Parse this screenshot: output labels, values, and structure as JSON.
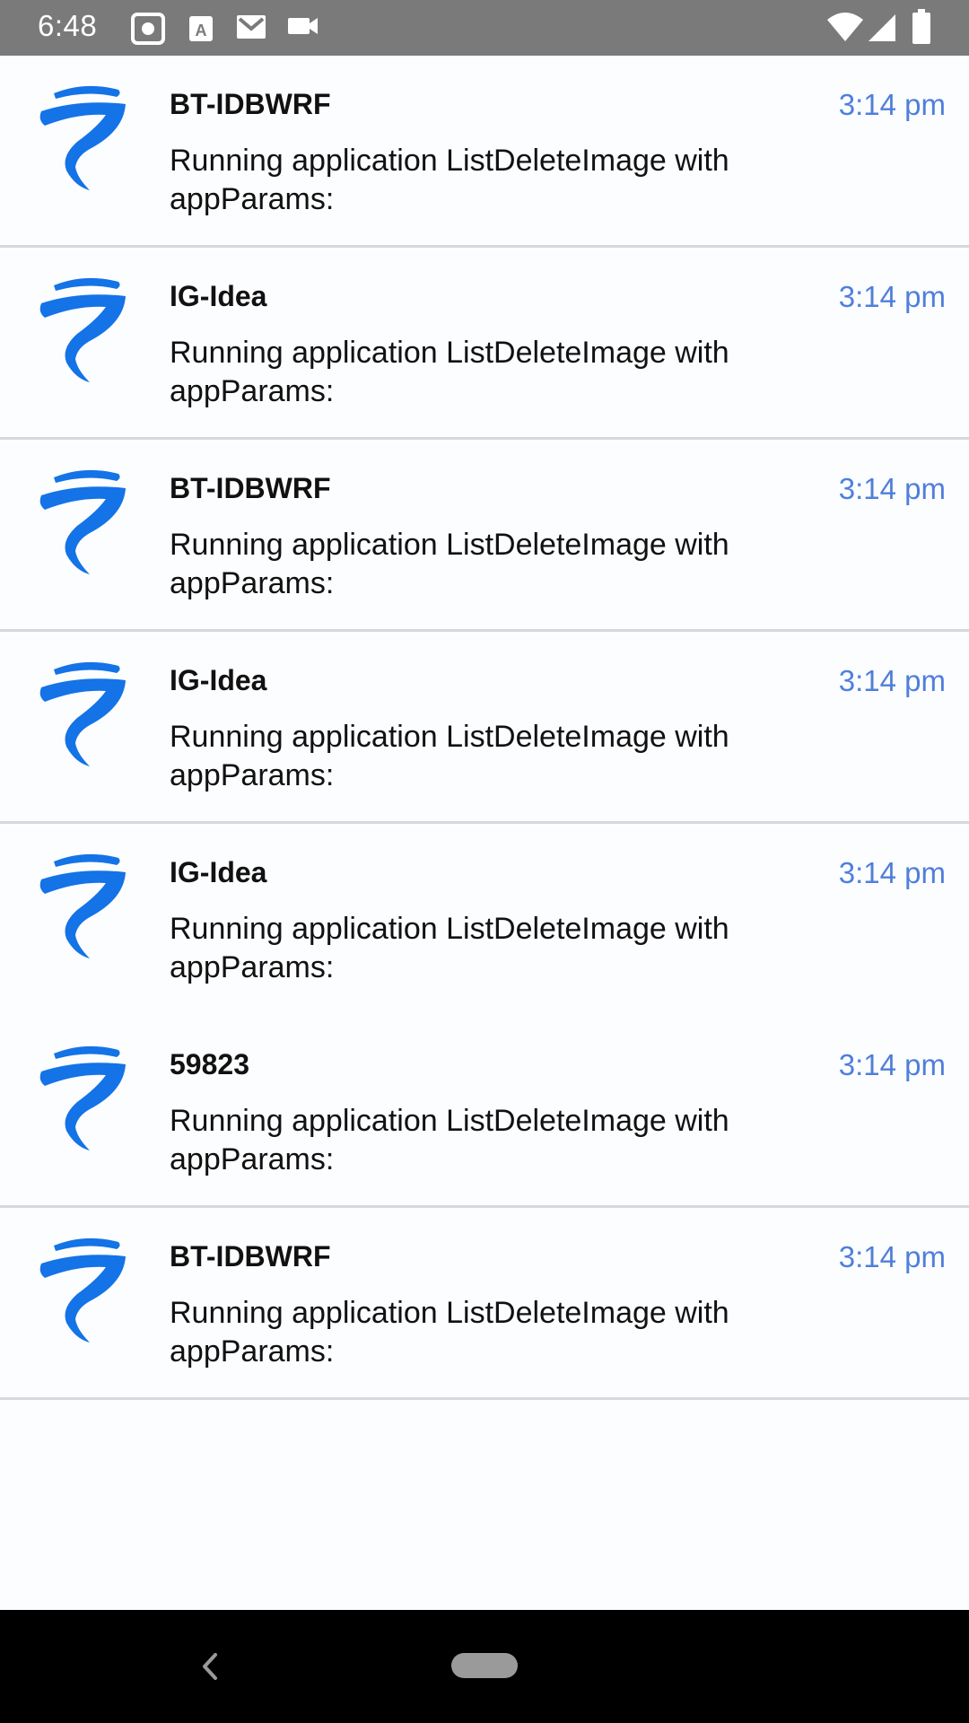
{
  "status_bar": {
    "time": "6:48",
    "icons": [
      "screenshot-icon",
      "accessibility-a-icon",
      "gmail-icon",
      "video-icon",
      "wifi-icon",
      "signal-icon",
      "battery-icon"
    ]
  },
  "colors": {
    "accent": "#4f7fdc",
    "icon_blue": "#1473e6",
    "status_bar": "#7a7a7a",
    "divider": "#d6d8de"
  },
  "notifications": [
    {
      "title": "BT-IDBWRF",
      "message": "Running application ListDeleteImage with appParams:",
      "time": "3:14 pm",
      "icon": "tornado-icon"
    },
    {
      "title": "IG-Idea",
      "message": "Running application ListDeleteImage with appParams:",
      "time": "3:14 pm",
      "icon": "tornado-icon"
    },
    {
      "title": "BT-IDBWRF",
      "message": "Running application ListDeleteImage with appParams:",
      "time": "3:14 pm",
      "icon": "tornado-icon"
    },
    {
      "title": "IG-Idea",
      "message": "Running application ListDeleteImage with appParams:",
      "time": "3:14 pm",
      "icon": "tornado-icon"
    },
    {
      "title": "IG-Idea",
      "message": "Running application ListDeleteImage with appParams:",
      "time": "3:14 pm",
      "icon": "tornado-icon"
    },
    {
      "title": "59823",
      "message": "Running application ListDeleteImage with appParams:",
      "time": "3:14 pm",
      "icon": "tornado-icon"
    },
    {
      "title": "BT-IDBWRF",
      "message": "Running application ListDeleteImage with appParams:",
      "time": "3:14 pm",
      "icon": "tornado-icon"
    }
  ],
  "nav_bar": {
    "icons": [
      "back-icon",
      "home-pill-icon"
    ]
  }
}
